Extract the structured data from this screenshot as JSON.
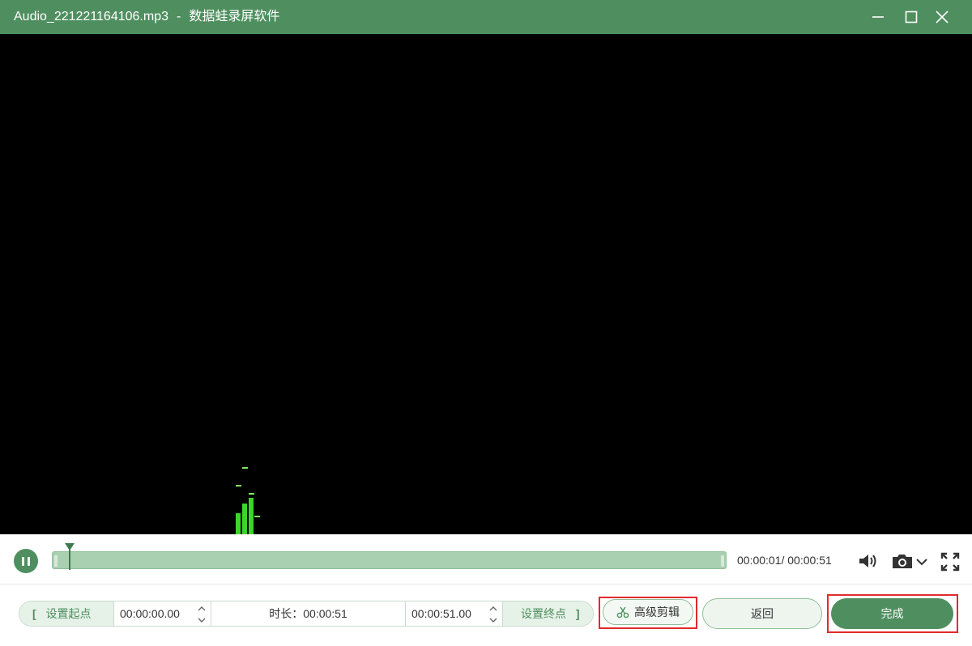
{
  "window": {
    "filename": "Audio_221221164106.mp3",
    "separator": "-",
    "app_name": "数据蛙录屏软件"
  },
  "visualizer": {
    "color": "#3dd42c",
    "bar_levels": [
      0.04,
      0.06,
      0.07
    ]
  },
  "player": {
    "state_icon": "pause-icon",
    "current_time": "00:00:01",
    "total_time": "00:00:51",
    "time_display": "00:00:01/ 00:00:51",
    "progress_fraction": 0.027
  },
  "trim": {
    "set_start_label": "设置起点",
    "start_time": "00:00:00.00",
    "duration_label": "时长：00:00:51",
    "end_time": "00:00:51.00",
    "set_end_label": "设置终点",
    "open_bracket": "[",
    "close_bracket": "]"
  },
  "buttons": {
    "advanced_cut": "高级剪辑",
    "back": "返回",
    "done": "完成"
  },
  "colors": {
    "accent": "#4f8f5f",
    "highlight": "#e02b2b"
  }
}
